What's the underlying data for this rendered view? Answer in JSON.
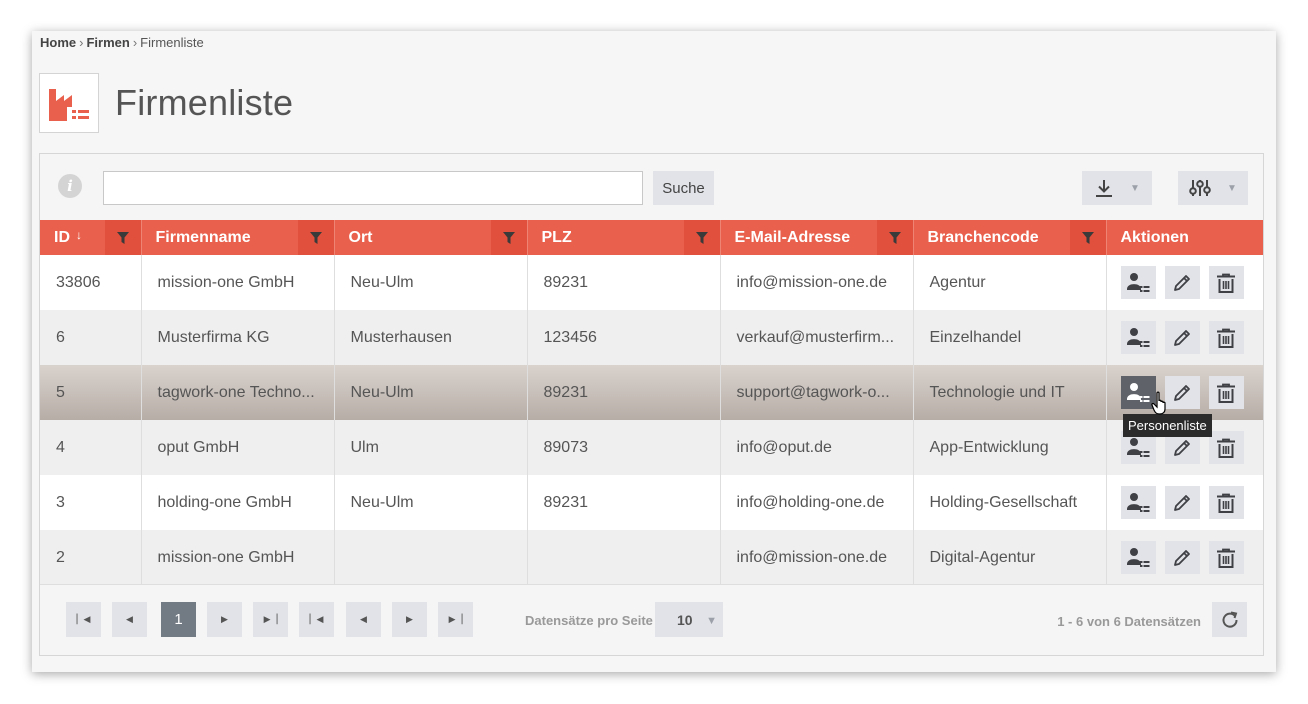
{
  "breadcrumb": {
    "home": "Home",
    "sep1": "›",
    "firmen": "Firmen",
    "sep2": "›",
    "current": "Firmenliste"
  },
  "page": {
    "title": "Firmenliste"
  },
  "toolbar": {
    "search_value": "",
    "search_label": "Suche"
  },
  "table": {
    "headers": {
      "id": "ID",
      "firmenname": "Firmenname",
      "ort": "Ort",
      "plz": "PLZ",
      "email": "E-Mail-Adresse",
      "branchencode": "Branchencode",
      "aktionen": "Aktionen"
    },
    "sort_indicator": "↓",
    "rows": [
      {
        "id": "33806",
        "firmenname": "mission-one GmbH",
        "ort": "Neu-Ulm",
        "plz": "89231",
        "email": "info@mission-one.de",
        "branchencode": "Agentur"
      },
      {
        "id": "6",
        "firmenname": "Musterfirma KG",
        "ort": "Musterhausen",
        "plz": "123456",
        "email": "verkauf@musterfirm...",
        "branchencode": "Einzelhandel"
      },
      {
        "id": "5",
        "firmenname": "tagwork-one Techno...",
        "ort": "Neu-Ulm",
        "plz": "89231",
        "email": "support@tagwork-o...",
        "branchencode": "Technologie und IT"
      },
      {
        "id": "4",
        "firmenname": "oput GmbH",
        "ort": "Ulm",
        "plz": "89073",
        "email": "info@oput.de",
        "branchencode": "App-Entwicklung"
      },
      {
        "id": "3",
        "firmenname": "holding-one GmbH",
        "ort": "Neu-Ulm",
        "plz": "89231",
        "email": "info@holding-one.de",
        "branchencode": "Holding-Gesellschaft"
      },
      {
        "id": "2",
        "firmenname": "mission-one GmbH",
        "ort": "",
        "plz": "",
        "email": "info@mission-one.de",
        "branchencode": "Digital-Agentur"
      }
    ]
  },
  "tooltip": "Personenliste",
  "pagination": {
    "current_page": "1",
    "per_page_label": "Datensätze pro Seite",
    "per_page_value": "10",
    "records": "1 - 6 von 6 Datensätzen"
  },
  "colors": {
    "accent": "#e9604c",
    "button_bg": "#e1e3e8"
  }
}
